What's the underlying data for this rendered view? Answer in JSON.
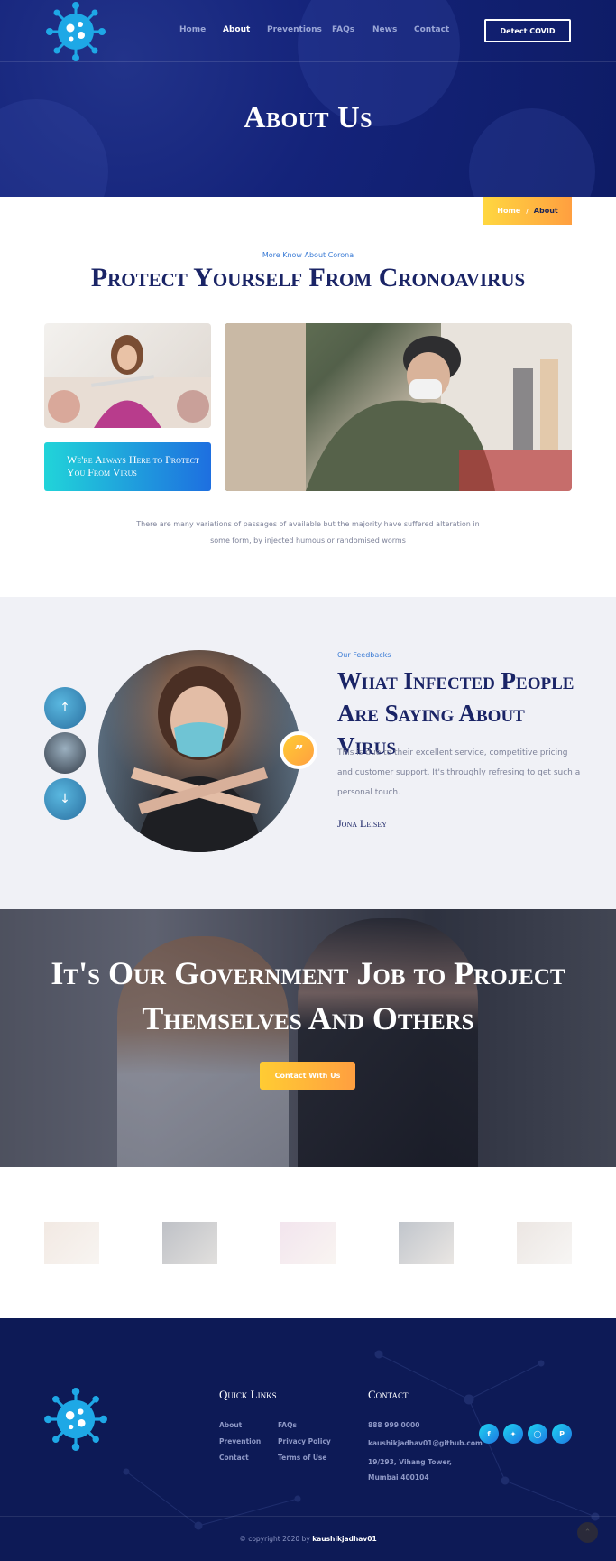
{
  "nav": {
    "items": [
      "Home",
      "About",
      "Preventions",
      "FAQs",
      "News",
      "Contact"
    ],
    "active": "About",
    "detect_button": "Detect COVID"
  },
  "hero": {
    "title": "About Us"
  },
  "breadcrumb": {
    "home": "Home",
    "separator": "/",
    "current": "About"
  },
  "about": {
    "eyebrow": "More Know About Corona",
    "title": "Protect Yourself From Cronoavirus",
    "card_text": "We're Always Here to Protect You From Virus",
    "body": "There are many variations of passages of available but the majority have suffered alteration in some form, by injected humous or randomised worms"
  },
  "testimonial": {
    "eyebrow": "Our Feedbacks",
    "title": "What Infected People Are Saying About Virus",
    "quote_mark": "”",
    "text": "This is due to their excellent service, competitive pricing and customer support. It's throughly refresing to get such a personal touch.",
    "author": "Jona Leisey",
    "thumbs": [
      "arrow-up-icon",
      "avatar",
      "arrow-down-icon"
    ]
  },
  "cta": {
    "title": "It's Our Government Job to Project Themselves And Others",
    "button": "Contact With Us"
  },
  "footer": {
    "quick_links_title": "Quick Links",
    "links_col1": [
      "About",
      "Prevention",
      "Contact"
    ],
    "links_col2": [
      "FAQs",
      "Privacy Policy",
      "Terms of Use"
    ],
    "contact_title": "Contact",
    "phone": "888 999 0000",
    "email": "kaushikjadhav01@github.com",
    "address_line1": "19/293, Vihang Tower,",
    "address_line2": "Mumbai 400104",
    "social": [
      "facebook-icon",
      "twitter-icon",
      "instagram-icon",
      "pinterest-icon"
    ],
    "copyright_prefix": "© copyright 2020 by",
    "copyright_name": "kaushikjadhav01"
  },
  "colors": {
    "navy": "#0d1a56",
    "accent_orange": "#ff9f40",
    "accent_yellow": "#ffcc33",
    "accent_blue": "#1e6fe0",
    "accent_cyan": "#21d4d9"
  }
}
